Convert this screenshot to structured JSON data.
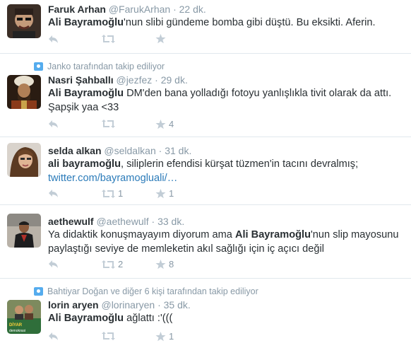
{
  "tweets": [
    {
      "context": "",
      "fullname": "Faruk Arhan",
      "handle": "@FarukArhan",
      "time": "· 22 dk.",
      "mention": "Ali Bayramoğlu",
      "rest": "'nun slibi gündeme bomba gibi düştü. Bu eksikti. Aferin.",
      "line2": "",
      "retweets": "",
      "favorites": ""
    },
    {
      "context": "Janko tarafından takip ediliyor",
      "fullname": "Nasri Şahballı",
      "handle": "@jezfez",
      "time": "· 29 dk.",
      "mention": "Ali Bayramoğlu",
      "rest": " DM'den bana yolladığı fotoyu yanlışlıkla tivit olarak da attı.",
      "line2": "Şapşik yaa <33",
      "retweets": "",
      "favorites": "4"
    },
    {
      "context": "",
      "fullname": "selda alkan",
      "handle": "@seldalkan",
      "time": "· 31 dk.",
      "mention": "ali bayramoğlu",
      "rest": ", siliplerin efendisi kürşat tüzmen'in tacını devralmış;",
      "link": "twitter.com/bayramogluali/…",
      "retweets": "1",
      "favorites": "1"
    },
    {
      "context": "",
      "fullname": "aethewulf",
      "handle": "@aethewulf",
      "time": "· 33 dk.",
      "pre": "Ya didaktik konuşmayayım diyorum ama ",
      "mention": "Ali Bayramoğlu",
      "rest": "'nun slip mayosunu",
      "line2": "paylaştığı seviye de memleketin akıl sağlığı için iç açıcı değil",
      "retweets": "2",
      "favorites": "8"
    },
    {
      "context": "Bahtiyar Doğan ve diğer 6 kişi tarafından takip ediliyor",
      "fullname": "lorin aryen",
      "handle": "@lorinaryen",
      "time": "· 35 dk.",
      "mention": "Ali Bayramoğlu",
      "rest": " ağlattı :'(((",
      "line2": "",
      "retweets": "",
      "favorites": "1",
      "avatar_text_1": "DİYAR",
      "avatar_text_2": "demokrasi"
    }
  ],
  "colors": {
    "name": "#292f33",
    "meta": "#8899a6",
    "link": "#2b7bb9",
    "divider": "#e1e8ed"
  },
  "icons": [
    "reply-icon",
    "retweet-icon",
    "favorite-icon",
    "follow-context-icon"
  ]
}
